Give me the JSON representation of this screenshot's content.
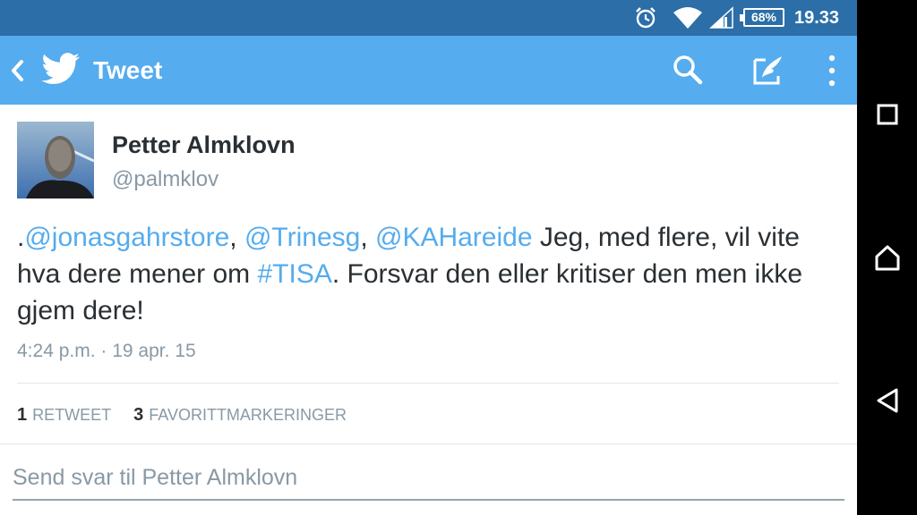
{
  "status_bar": {
    "battery_percent": "68%",
    "time": "19.33",
    "icons": [
      "alarm-icon",
      "wifi-icon",
      "signal-icon",
      "battery-icon"
    ]
  },
  "action_bar": {
    "title": "Tweet",
    "icons": [
      "back-icon",
      "twitter-bird-icon",
      "search-icon",
      "compose-icon",
      "overflow-menu-icon"
    ]
  },
  "tweet": {
    "author_name": "Petter Almklovn",
    "author_handle": "@palmklov",
    "text_parts": {
      "p0": ".",
      "p1": "@jonasgahrstore",
      "p2": ", ",
      "p3": "@Trinesg",
      "p4": ", ",
      "p5": "@KAHareide",
      "p6": " Jeg, med flere, vil vite hva dere mener om ",
      "p7": "#TISA",
      "p8": ". Forsvar den eller kritiser den men ikke gjem dere!"
    },
    "timestamp": "4:24 p.m. · 19 apr. 15",
    "stats": {
      "retweets_count": "1",
      "retweets_label": "RETWEET",
      "favorites_count": "3",
      "favorites_label": "FAVORITTMARKERINGER"
    }
  },
  "reply": {
    "placeholder": "Send svar til Petter Almklovn"
  },
  "navigation_bar": {
    "icons": [
      "recent-apps-icon",
      "home-icon",
      "back-nav-icon"
    ]
  },
  "colors": {
    "status_bar": "#2b6ea8",
    "action_bar": "#55acee",
    "link": "#55acee",
    "secondary_text": "#8899a6",
    "primary_text": "#292f33"
  }
}
